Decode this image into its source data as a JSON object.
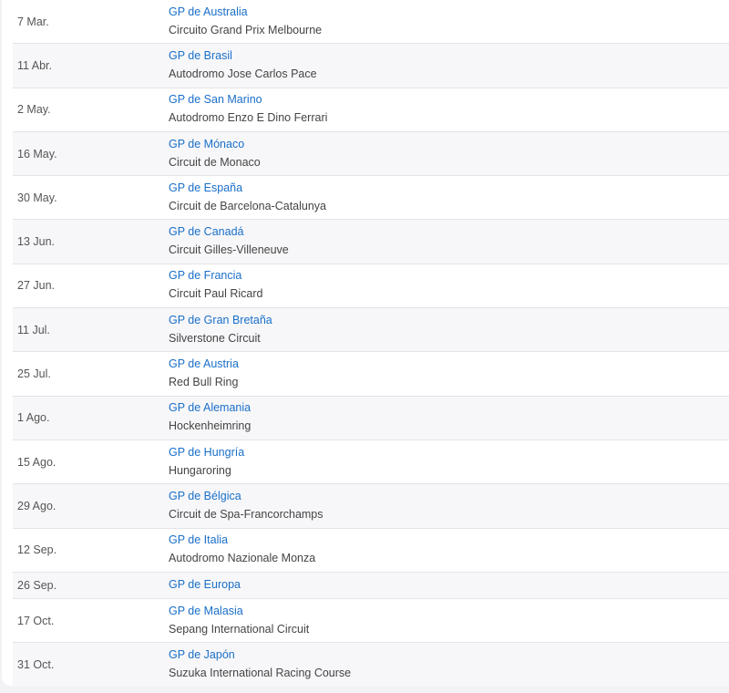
{
  "races": [
    {
      "date": "7 Mar.",
      "gp": "GP de Australia",
      "circuit": "Circuito Grand Prix Melbourne"
    },
    {
      "date": "11 Abr.",
      "gp": "GP de Brasil",
      "circuit": "Autodromo Jose Carlos Pace"
    },
    {
      "date": "2 May.",
      "gp": "GP de San Marino",
      "circuit": "Autodromo Enzo E Dino Ferrari"
    },
    {
      "date": "16 May.",
      "gp": "GP de Mónaco",
      "circuit": "Circuit de Monaco"
    },
    {
      "date": "30 May.",
      "gp": "GP de España",
      "circuit": "Circuit de Barcelona-Catalunya"
    },
    {
      "date": "13 Jun.",
      "gp": "GP de Canadá",
      "circuit": "Circuit Gilles-Villeneuve"
    },
    {
      "date": "27 Jun.",
      "gp": "GP de Francia",
      "circuit": "Circuit Paul Ricard"
    },
    {
      "date": "11 Jul.",
      "gp": "GP de Gran Bretaña",
      "circuit": "Silverstone Circuit"
    },
    {
      "date": "25 Jul.",
      "gp": "GP de Austria",
      "circuit": "Red Bull Ring"
    },
    {
      "date": "1 Ago.",
      "gp": "GP de Alemania",
      "circuit": "Hockenheimring"
    },
    {
      "date": "15 Ago.",
      "gp": "GP de Hungría",
      "circuit": "Hungaroring"
    },
    {
      "date": "29 Ago.",
      "gp": "GP de Bélgica",
      "circuit": "Circuit de Spa-Francorchamps"
    },
    {
      "date": "12 Sep.",
      "gp": "GP de Italia",
      "circuit": "Autodromo Nazionale Monza"
    },
    {
      "date": "26 Sep.",
      "gp": "GP de Europa",
      "circuit": ""
    },
    {
      "date": "17 Oct.",
      "gp": "GP de Malasia",
      "circuit": "Sepang International Circuit"
    },
    {
      "date": "31 Oct.",
      "gp": "GP de Japón",
      "circuit": "Suzuka International Racing Course"
    }
  ]
}
